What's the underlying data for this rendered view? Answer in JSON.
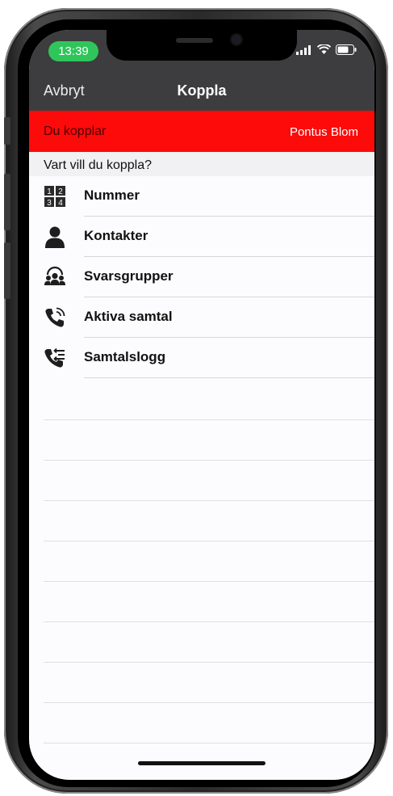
{
  "status_bar": {
    "time": "13:39"
  },
  "nav": {
    "cancel_label": "Avbryt",
    "title": "Koppla"
  },
  "transfer_banner": {
    "label": "Du kopplar",
    "contact_name": "Pontus Blom"
  },
  "section": {
    "title": "Vart vill du koppla?"
  },
  "options": [
    {
      "label": "Nummer",
      "icon": "dialpad-icon"
    },
    {
      "label": "Kontakter",
      "icon": "person-icon"
    },
    {
      "label": "Svarsgrupper",
      "icon": "group-icon"
    },
    {
      "label": "Aktiva samtal",
      "icon": "active-call-icon"
    },
    {
      "label": "Samtalslogg",
      "icon": "call-log-icon"
    }
  ],
  "colors": {
    "nav_bg": "#3d3d3f",
    "banner_red": "#fd0a0a",
    "time_pill_green": "#30c55a"
  }
}
